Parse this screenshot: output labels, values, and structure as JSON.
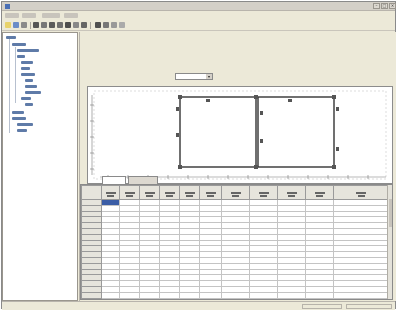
{
  "window": {
    "title": "",
    "close_glyph": "×",
    "minimize_glyph": "–",
    "maximize_glyph": "□"
  },
  "menu": [
    {
      "label": ""
    },
    {
      "label": ""
    },
    {
      "label": ""
    },
    {
      "label": ""
    }
  ],
  "toolbar": {
    "buttons": [
      {
        "icon": "new-icon"
      },
      {
        "icon": "open-icon"
      },
      {
        "icon": "save-icon"
      },
      {
        "icon": "print-icon"
      },
      {
        "icon": "copy-icon"
      },
      {
        "icon": "paste-icon"
      },
      {
        "icon": "zoom-icon"
      },
      {
        "icon": "grid-icon"
      },
      {
        "icon": "chart-icon"
      },
      {
        "icon": "table-icon"
      },
      {
        "icon": "settings-icon"
      },
      {
        "icon": "help-icon"
      }
    ]
  },
  "sidebar": {
    "tree": []
  },
  "chart_panel": {
    "title": "",
    "select_value": "",
    "select_arrow": "▾"
  },
  "tabs": {
    "main_label": "",
    "items": [
      {
        "label": ""
      },
      {
        "label": ""
      }
    ]
  },
  "grid": {
    "headers": [
      "",
      "",
      "",
      "",
      "",
      "",
      "",
      "",
      "",
      "",
      "",
      ""
    ],
    "row_count": 18
  },
  "status": {
    "left": "",
    "right": ""
  },
  "colors": {
    "selection": "#3b5da6",
    "tree_node": "#5f7ba8",
    "chart_line": "#333333"
  }
}
